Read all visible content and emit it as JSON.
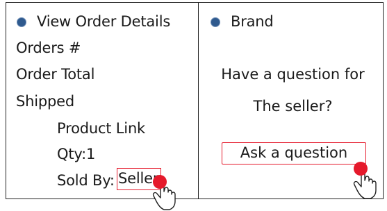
{
  "left_panel": {
    "header": "View Order Details",
    "orders": "Orders #",
    "order_total": "Order Total",
    "shipped": "Shipped",
    "product_link": "Product Link",
    "qty": "Qty:1",
    "sold_by_label": "Sold By:",
    "seller_link": "Seller"
  },
  "right_panel": {
    "header": "Brand",
    "question_line1": "Have a question for",
    "question_line2": "The seller?",
    "ask_button": "Ask a question"
  },
  "colors": {
    "bullet": "#2f5a8e",
    "highlight": "#e5192b"
  },
  "icons": [
    "bullet-dot-icon",
    "hand-pointer-cursor-icon",
    "click-indicator-icon"
  ]
}
